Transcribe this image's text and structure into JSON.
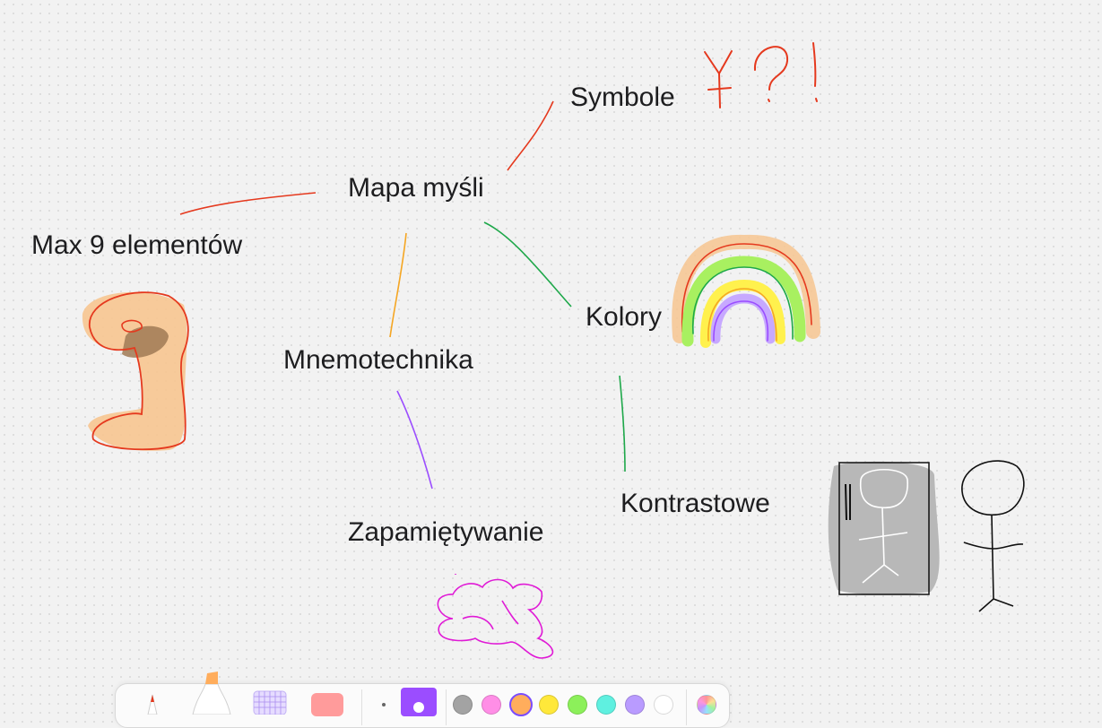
{
  "canvas": {
    "labels": {
      "mind_map": "Mapa myśli",
      "symbols": "Symbole",
      "max_elements": "Max 9 elementów",
      "colors": "Kolory",
      "mnemotechnics": "Mnemotechnika",
      "contrastive": "Kontrastowe",
      "memorizing": "Zapamiętywanie"
    },
    "stroke_colors": {
      "red": "#e5391e",
      "orange": "#f5a623",
      "green": "#1ea84a",
      "purple": "#9b4dff",
      "magenta": "#e01ad6",
      "highlight_orange": "#f7c590",
      "gray_fill": "#b8b8b8",
      "black": "#111111"
    }
  },
  "toolbar": {
    "tools": [
      "pencil-tool",
      "marker-tool",
      "pattern-tool",
      "eraser-tool"
    ],
    "stroke_sizes": [
      "small",
      "large"
    ],
    "selected_stroke_size": "large",
    "color_swatches": [
      "#a3a3a3",
      "#ff8ee6",
      "#ffad5c",
      "#ffe83a",
      "#8cf05a",
      "#5ff0e0",
      "#b99bff",
      "#ffffff"
    ],
    "selected_color": "#ffad5c",
    "color_picker_icon": "color-wheel-icon"
  }
}
